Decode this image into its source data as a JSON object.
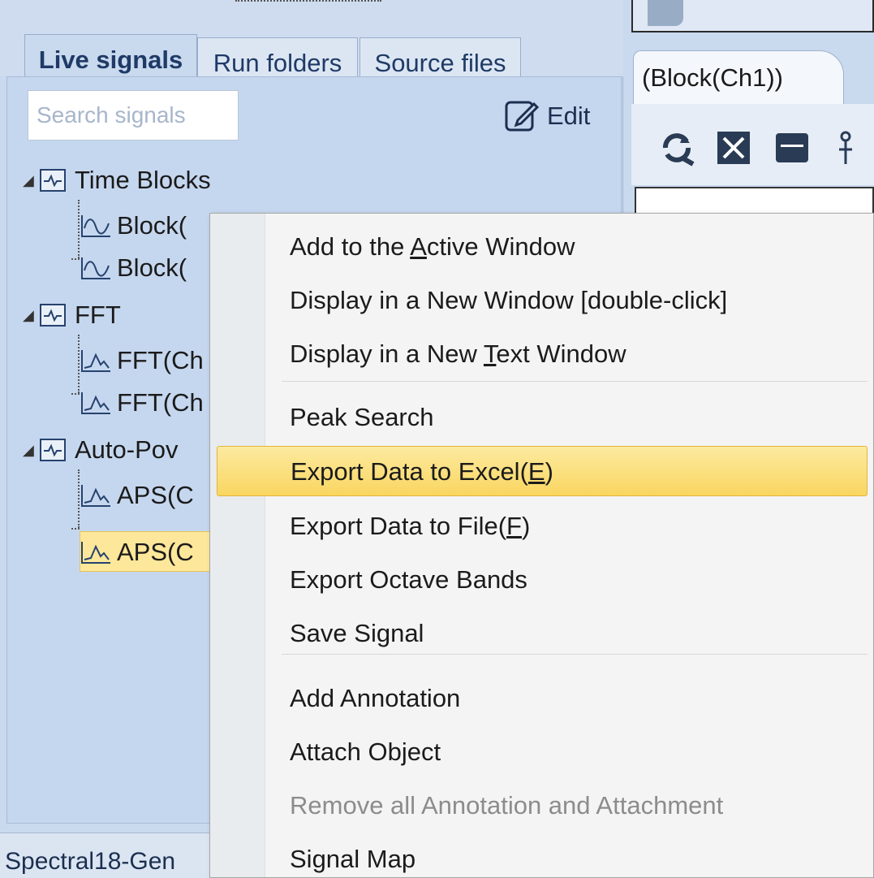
{
  "left_panel": {
    "tabs": [
      "Live signals",
      "Run folders",
      "Source files"
    ],
    "search_placeholder": "Search signals",
    "edit_label": "Edit",
    "tree": {
      "groups": [
        {
          "label": "Time Blocks",
          "children": [
            "Block(",
            "Block("
          ]
        },
        {
          "label": "FFT",
          "children": [
            "FFT(Ch",
            "FFT(Ch"
          ]
        },
        {
          "label": "Auto-Pov",
          "children": [
            "APS(C",
            "APS(C"
          ]
        }
      ],
      "selected": "APS(C"
    },
    "status_text": "Spectral18-Gen"
  },
  "right_panel": {
    "tab_label": "(Block(Ch1))",
    "toolbar_icons": [
      "refresh-icon",
      "fit-icon",
      "window-icon",
      "cursor-icon"
    ]
  },
  "context_menu": {
    "items": [
      {
        "pre": "Add to the ",
        "key": "A",
        "post": "ctive Window",
        "enabled": true
      },
      {
        "pre": "Display in a New Window [double-click]",
        "key": "",
        "post": "",
        "enabled": true
      },
      {
        "pre": "Display in a New ",
        "key": "T",
        "post": "ext Window",
        "enabled": true
      },
      {
        "pre": "Peak Search",
        "key": "",
        "post": "",
        "enabled": true
      },
      {
        "pre": "Export Data to Excel(",
        "key": "E",
        "post": ")",
        "enabled": true,
        "highlighted": true
      },
      {
        "pre": "Export Data to File(",
        "key": "F",
        "post": ")",
        "enabled": true
      },
      {
        "pre": "Export Octave Bands",
        "key": "",
        "post": "",
        "enabled": true
      },
      {
        "pre": "Save Signal",
        "key": "",
        "post": "",
        "enabled": true
      },
      {
        "pre": "Add Annotation",
        "key": "",
        "post": "",
        "enabled": true
      },
      {
        "pre": "Attach Object",
        "key": "",
        "post": "",
        "enabled": true
      },
      {
        "pre": "Remove all Annotation and Attachment",
        "key": "",
        "post": "",
        "enabled": false
      },
      {
        "pre": "Signal Map",
        "key": "",
        "post": "",
        "enabled": true
      }
    ]
  },
  "colors": {
    "panel_bg": "#c9d9ee",
    "highlight": "#f9d660",
    "selection": "#fde79a"
  }
}
